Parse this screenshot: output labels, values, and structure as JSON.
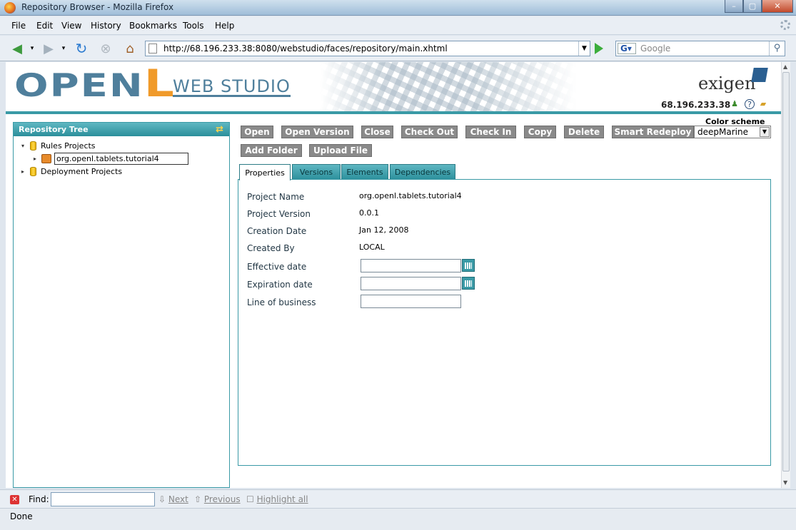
{
  "window": {
    "title": "Repository Browser - Mozilla Firefox",
    "min": "–",
    "max": "▢",
    "close": "✕"
  },
  "menu": [
    "File",
    "Edit",
    "View",
    "History",
    "Bookmarks",
    "Tools",
    "Help"
  ],
  "nav": {
    "url": "http://68.196.233.38:8080/webstudio/faces/repository/main.xhtml",
    "search_placeholder": "Google",
    "search_engine": "G"
  },
  "header": {
    "logo_main": "OPEN",
    "logo_l": "L",
    "logo_sub": "WEB STUDIO",
    "brand": "exigen",
    "host": "68.196.233.38",
    "help_icon": "?",
    "colors": {
      "teal": "#3a9aa6",
      "logo_blue": "#4f7f9c",
      "logo_orange": "#f09a2a"
    }
  },
  "tree": {
    "title": "Repository Tree",
    "nodes": [
      {
        "label": "Rules Projects",
        "expanded": true
      },
      {
        "label": "org.openl.tablets.tutorial4",
        "selected": true
      },
      {
        "label": "Deployment Projects",
        "expanded": false
      }
    ]
  },
  "toolbar": {
    "buttons": [
      "Open",
      "Open Version",
      "Close",
      "Check Out",
      "Check In",
      "Copy",
      "Delete",
      "Smart Redeploy",
      "Add Folder",
      "Upload File"
    ],
    "color_scheme_label": "Color scheme",
    "color_scheme_value": "deepMarine"
  },
  "tabs": [
    "Properties",
    "Versions",
    "Elements",
    "Dependencies"
  ],
  "properties": [
    {
      "label": "Project Name",
      "value": "org.openl.tablets.tutorial4"
    },
    {
      "label": "Project Version",
      "value": "0.0.1"
    },
    {
      "label": "Creation Date",
      "value": "Jan 12, 2008"
    },
    {
      "label": "Created By",
      "value": "LOCAL"
    },
    {
      "label": "Effective date",
      "value": ""
    },
    {
      "label": "Expiration date",
      "value": ""
    },
    {
      "label": "Line of business",
      "value": ""
    }
  ],
  "findbar": {
    "label": "Find:",
    "next": "Next",
    "previous": "Previous",
    "highlight": "Highlight all"
  },
  "status": "Done"
}
